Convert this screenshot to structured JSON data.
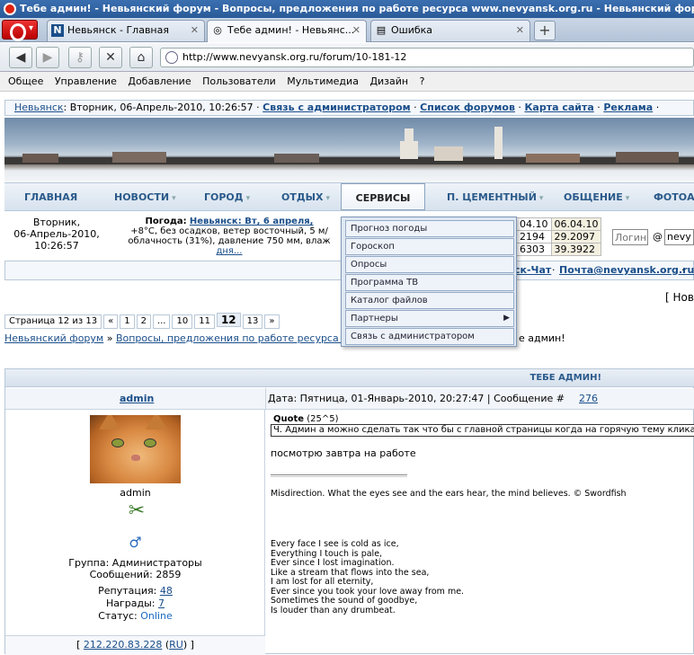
{
  "window_title": "Тебе админ! - Невьянский форум - Вопросы, предложения по работе ресурса www.nevyansk.org.ru - Невьянский форум - Opera",
  "tabs": [
    {
      "label": "Невьянск - Главная",
      "icon": "N"
    },
    {
      "label": "Тебе админ! - Невьянс...",
      "icon": "◎"
    },
    {
      "label": "Ошибка",
      "icon": "▤"
    }
  ],
  "url": "http://www.nevyansk.org.ru/forum/10-181-12",
  "menu": [
    "Общее",
    "Управление",
    "Добавление",
    "Пользователи",
    "Мультимедиа",
    "Дизайн",
    "?"
  ],
  "topline": {
    "site": "Невьянск",
    "date": ": Вторник, 06-Апрель-2010, 10:26:57 ·",
    "links": [
      "Связь с администратором",
      "Список форумов",
      "Карта сайта",
      "Реклама"
    ]
  },
  "nav": [
    "ГЛАВНАЯ",
    "НОВОСТИ",
    "ГОРОД",
    "ОТДЫХ",
    "СЕРВИСЫ",
    "П. ЦЕМЕНТНЫЙ",
    "ОБЩЕНИЕ",
    "ФОТОАЛ"
  ],
  "info": {
    "date1": "Вторник,",
    "date2": "06-Апрель-2010,",
    "date3": "10:26:57",
    "weather_label": "Погода:",
    "weather_link": "Невьянск: Вт, 6 апреля,",
    "weather1": "+8°C, без осадков, ветер восточный, 5 м/",
    "weather2": "облачность (31%), давление 750 мм, влаж",
    "weather3": "дня...",
    "rates": [
      [
        "04.10",
        "06.04.10"
      ],
      [
        "2194",
        "29.2097"
      ],
      [
        "6303",
        "39.3922"
      ]
    ],
    "login_placeholder": "Логин",
    "at": "@",
    "domain": "nevy",
    "chat": "ск-Чат",
    "mail": "Почта@nevyansk.org.ru",
    "new": "[ Нов"
  },
  "dropdown": [
    "Прогноз погоды",
    "Гороскоп",
    "Опросы",
    "Программа ТВ",
    "Каталог файлов",
    "Партнеры",
    "Связь с администратором"
  ],
  "pager": {
    "label": "Страница 12 из 13",
    "items": [
      "«",
      "1",
      "2",
      "...",
      "10",
      "11",
      "12",
      "13",
      "»"
    ]
  },
  "breadcrumb": {
    "forum": "Невьянский форум",
    "section": "Вопросы, предложения по работе ресурса www.nev",
    "tail": "е админ!"
  },
  "post": {
    "thread_title": "ТЕБЕ АДМИН!",
    "author": "admin",
    "meta_date": "Дата: Пятница, 01-Январь-2010, 20:27:47 | Сообщение #",
    "meta_num": "276",
    "username": "admin",
    "gender": "♂",
    "group": "Группа: Администраторы",
    "posts": "Сообщений: 2859",
    "rep_label": "Репутация:",
    "rep": "48",
    "awards_label": "Награды:",
    "awards": "7",
    "status_label": "Статус:",
    "status": "Online",
    "ip": "212.220.83.228",
    "country": "RU",
    "quote_label": "Quote",
    "quote_count": "(25^5)",
    "quote_text": "Ч. Админ а можно сделать так что бы с главной страницы когда на горячую тему кликаешь п",
    "reply": "посмотрю завтра на работе",
    "sig1": "Misdirection. What the eyes see and the ears hear, the mind believes. © Swordfish",
    "poem": [
      "Every face I see is cold as ice,",
      "Everything I touch is pale,",
      "Ever since I lost imagination.",
      "Like a stream that flows into the sea,",
      "I am lost for all eternity,",
      "Ever since you took your love away from me.",
      "Sometimes the sound of goodbye,",
      "Is louder than any drumbeat."
    ]
  }
}
